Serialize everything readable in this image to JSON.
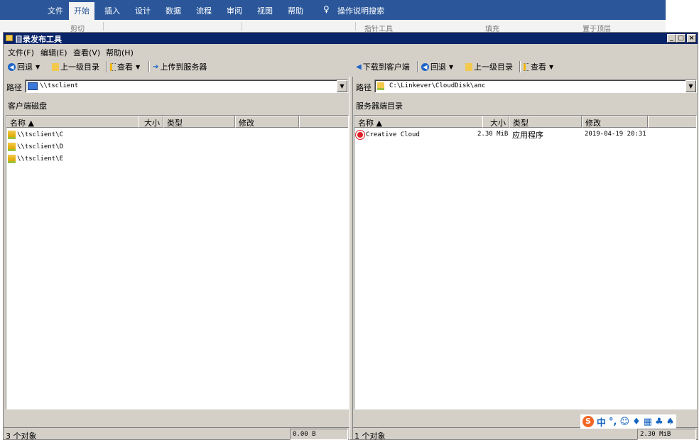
{
  "ribbon": {
    "tabs": [
      "文件",
      "开始",
      "插入",
      "设计",
      "数据",
      "流程",
      "审阅",
      "视图",
      "帮助"
    ],
    "active_tab": "开始",
    "search_label": "操作说明搜索",
    "body_items": [
      "剪切",
      "指针工具",
      "填充",
      "置于顶层"
    ]
  },
  "window": {
    "title": "目录发布工具",
    "min": "_",
    "max": "□",
    "close": "×"
  },
  "menu": [
    "文件(F)",
    "编辑(E)",
    "查看(V)",
    "帮助(H)"
  ],
  "left": {
    "toolbar": {
      "back": "回退",
      "up": "上一级目录",
      "view": "查看",
      "upload": "上传到服务器"
    },
    "path_label": "路径",
    "path": "\\\\tsclient",
    "pane_title": "客户端磁盘",
    "columns": {
      "name": "名称 ▲",
      "size": "大小",
      "type": "类型",
      "modified": "修改"
    },
    "rows": [
      {
        "name": "\\\\tsclient\\C"
      },
      {
        "name": "\\\\tsclient\\D"
      },
      {
        "name": "\\\\tsclient\\E"
      }
    ],
    "status_count": "3 个对象",
    "status_size": "0.00 B"
  },
  "right": {
    "toolbar": {
      "download": "下载到客户端",
      "back": "回退",
      "up": "上一级目录",
      "view": "查看"
    },
    "path_label": "路径",
    "path": "C:\\Linkever\\CloudDisk\\anc",
    "pane_title": "服务器端目录",
    "columns": {
      "name": "名称 ▲",
      "size": "大小",
      "type": "类型",
      "modified": "修改"
    },
    "rows": [
      {
        "name": "Creative Cloud",
        "size": "2.30 MiB",
        "type": "应用程序",
        "modified": "2019-04-19 20:31"
      }
    ],
    "status_count": "1 个对象",
    "status_size": "2.30 MiB"
  },
  "ime": {
    "logo": "S",
    "lang": "中",
    "punct": "°,"
  }
}
